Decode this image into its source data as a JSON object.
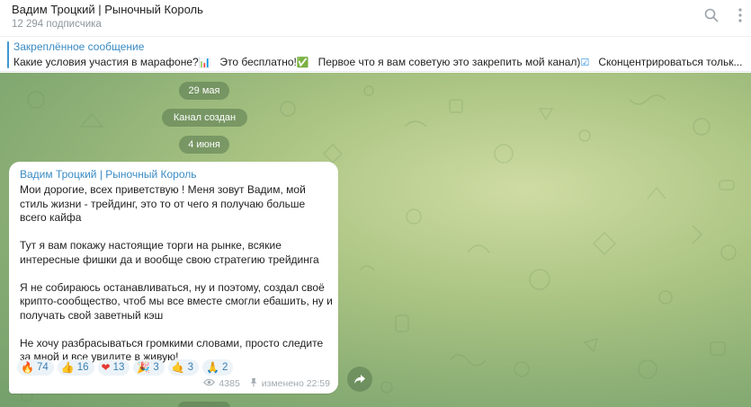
{
  "header": {
    "title": "Вадим Троцкий | Рыночный Король",
    "subscribers": "12 294 подписчика",
    "icons": [
      "search-icon",
      "more-icon"
    ]
  },
  "pinned": {
    "label": "Закреплённое сообщение",
    "segments": [
      {
        "text": "Какие условия участия в марафоне?",
        "emoji": "📊"
      },
      {
        "text": "Это бесплатно!",
        "emoji": "✅"
      },
      {
        "text": "Первое что я вам советую это закрепить мой канал)",
        "emoji": "☑"
      },
      {
        "text": "Сконцентрироваться тольк...",
        "emoji": ""
      }
    ]
  },
  "chat": {
    "date_1": "29 мая",
    "service": "Канал создан",
    "date_2": "4 июня",
    "message": {
      "author": "Вадим Троцкий | Рыночный Король",
      "paragraphs": [
        "Мои дорогие, всех приветствую ! Меня зовут Вадим, мой стиль жизни - трейдинг, это то от чего я получаю больше всего кайфа",
        "Тут я вам покажу настоящие торги на рынке, всякие интересные фишки да и вообще свою стратегию трейдинга",
        "Я не собираюсь останавливаться, ну и поэтому, создал своё крипто-сообщество, чтоб мы все вместе смогли ебашить, ну и получать свой заветный кэш",
        "Не хочу разбрасываться громкими словами, просто следите за мной и все увидите в живую!"
      ],
      "reactions": [
        {
          "emoji": "🔥",
          "count": "74"
        },
        {
          "emoji": "👍",
          "count": "16"
        },
        {
          "emoji": "❤",
          "count": "13"
        },
        {
          "emoji": "🎉",
          "count": "3"
        },
        {
          "emoji": "🤙",
          "count": "3"
        },
        {
          "emoji": "🙏",
          "count": "2"
        }
      ],
      "views": "4385",
      "edited": "изменено 22:59"
    }
  },
  "colors": {
    "accent": "#3a8bc4",
    "chat_bg": "#a9c382",
    "pill_bg": "#6e8e62"
  }
}
